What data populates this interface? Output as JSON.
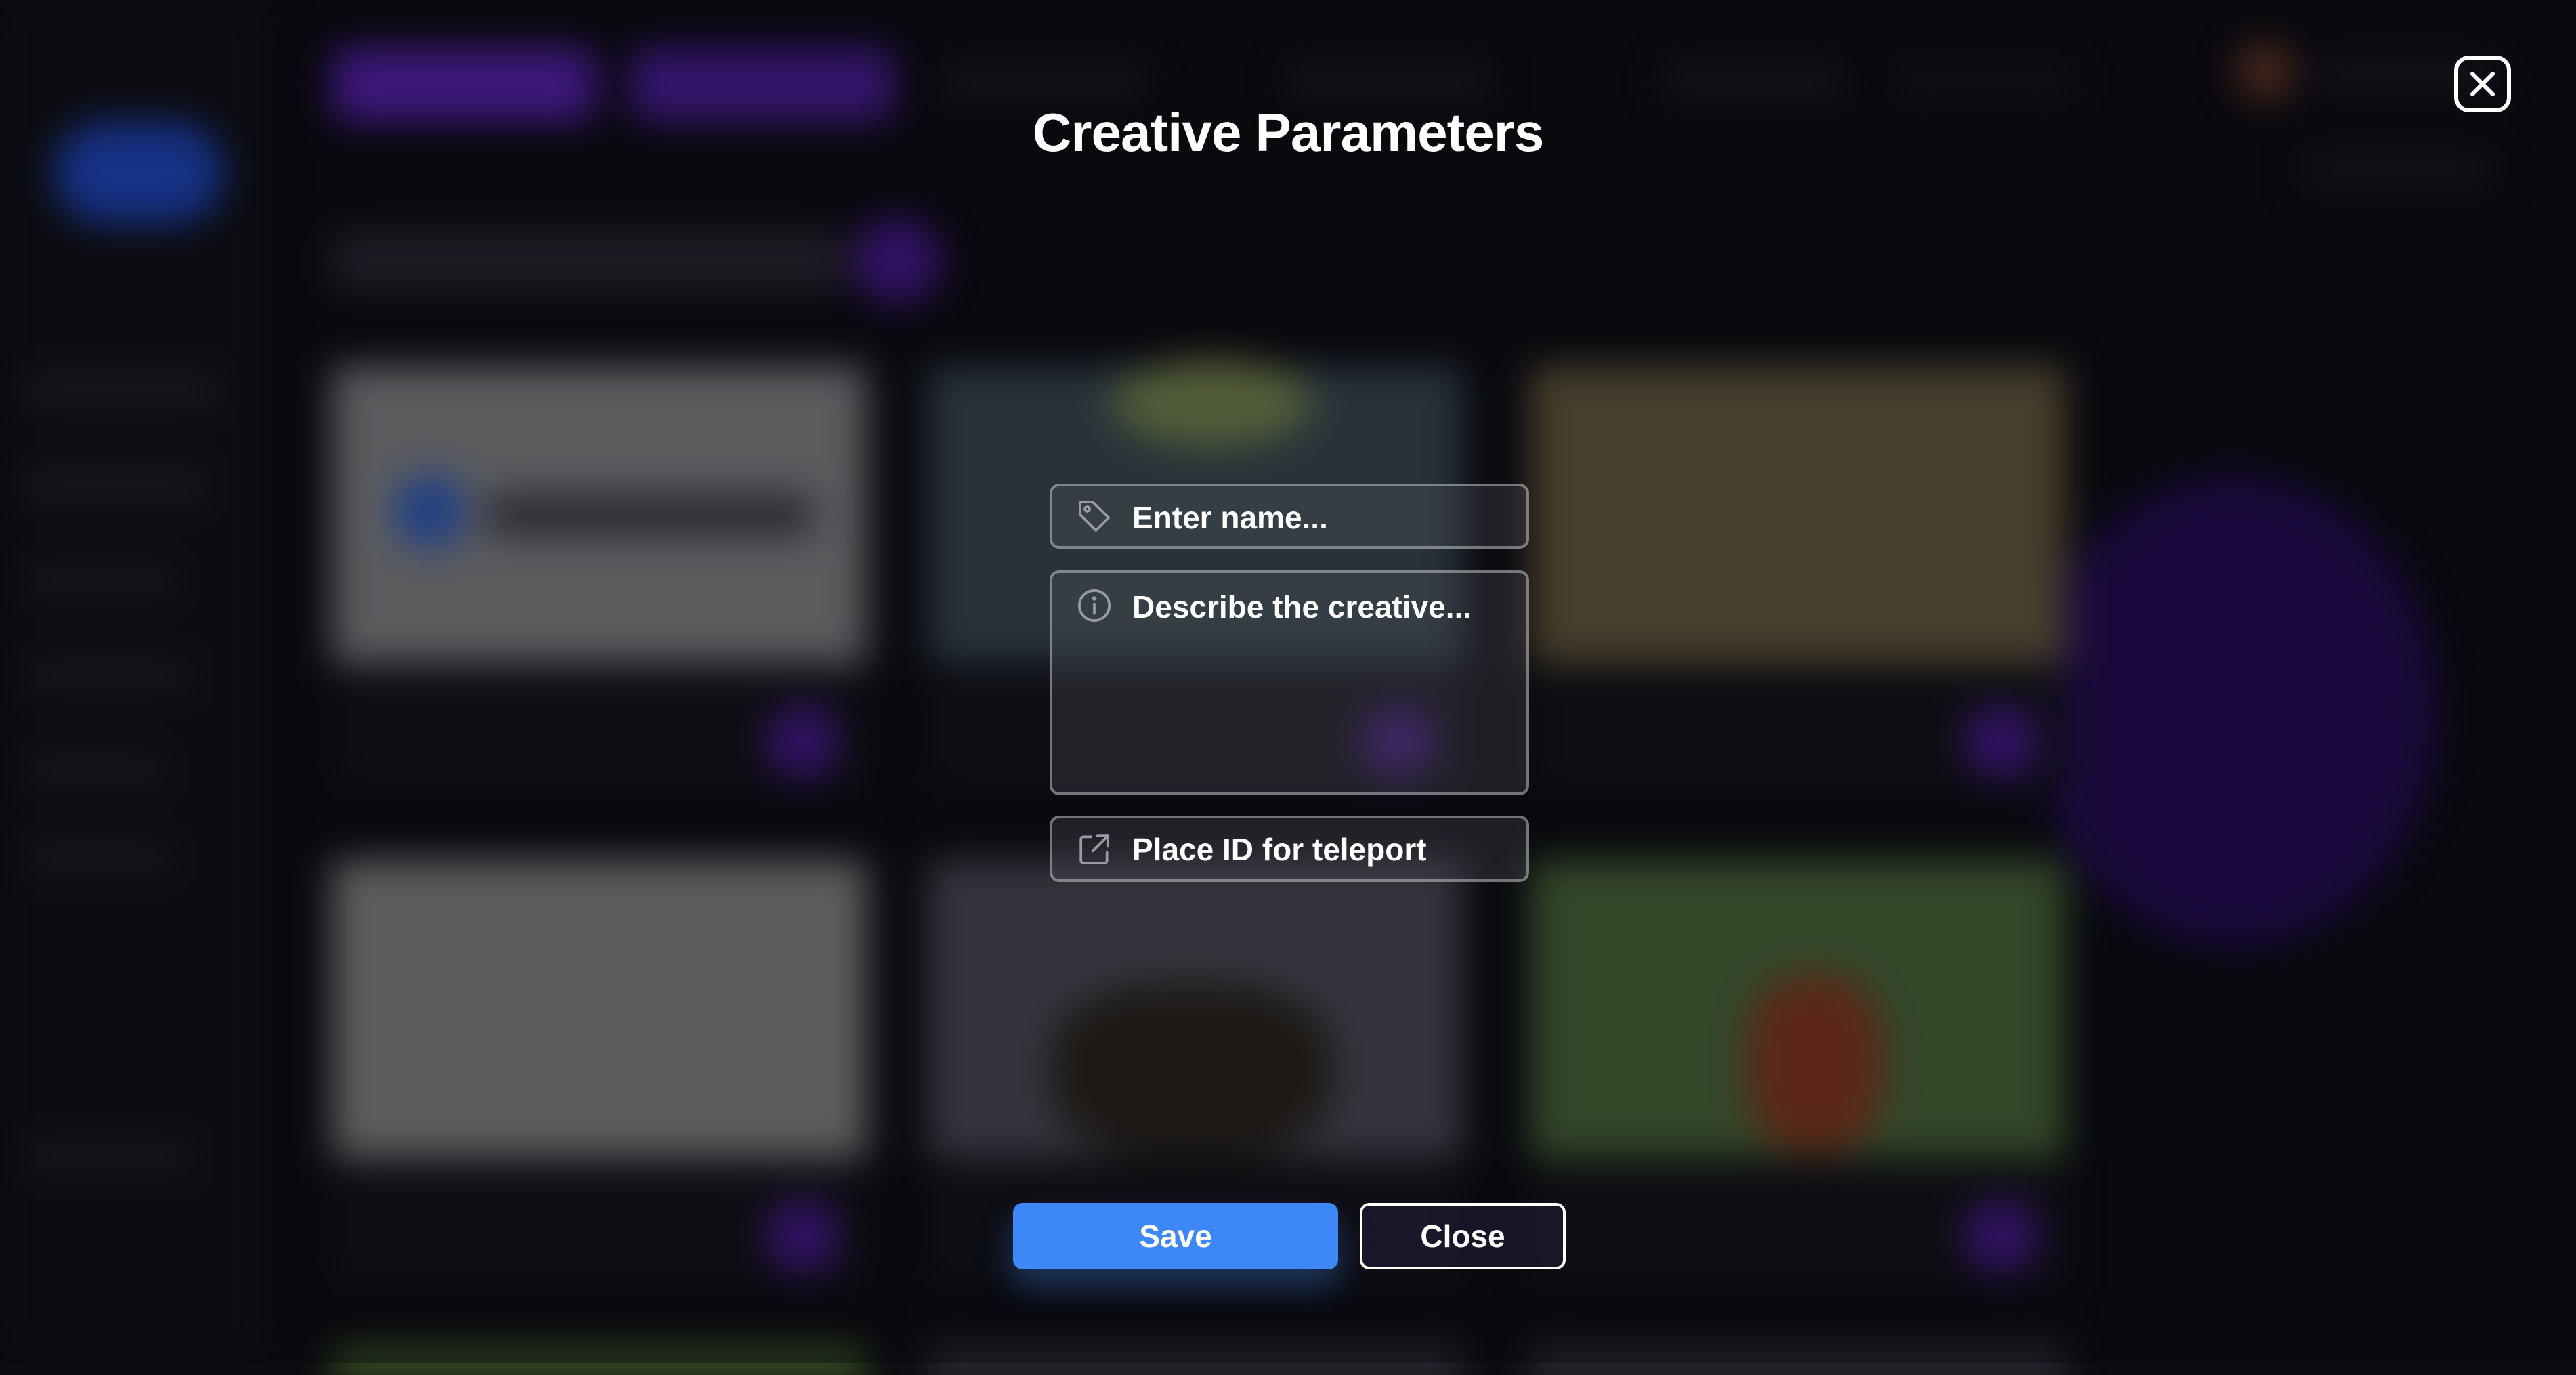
{
  "modal": {
    "title": "Creative Parameters",
    "close_icon": "close-x-icon",
    "fields": {
      "name": {
        "icon": "tag-icon",
        "placeholder": "Enter name...",
        "value": ""
      },
      "description": {
        "icon": "info-circle-icon",
        "placeholder": "Describe the creative...",
        "value": ""
      },
      "place_id": {
        "icon": "external-link-icon",
        "placeholder": "Place ID for teleport",
        "value": ""
      }
    },
    "buttons": {
      "save_label": "Save",
      "close_label": "Close"
    }
  },
  "colors": {
    "background": "#0b0b10",
    "save_button": "#3e87f7",
    "accent_purple": "#6a2bd0"
  }
}
